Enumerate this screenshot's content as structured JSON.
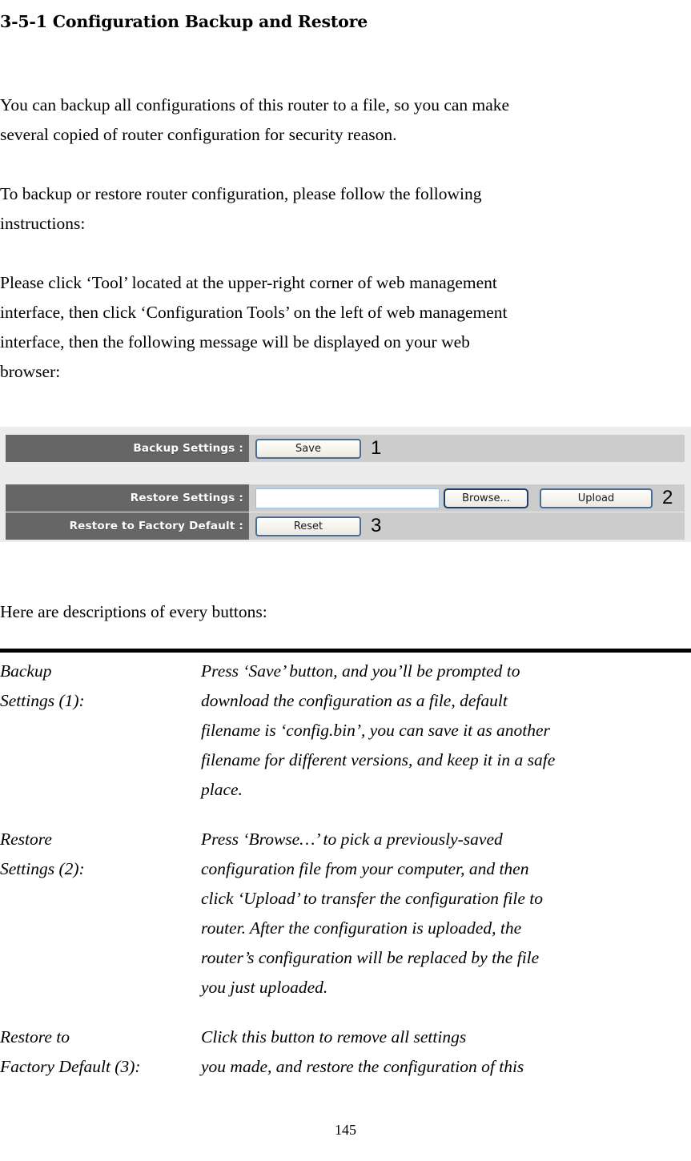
{
  "document": {
    "heading": "3-5-1 Configuration Backup and Restore",
    "page_number": "145",
    "paragraphs": [
      {
        "id": "intro",
        "lines": [
          "You can backup all configurations of this router to a file, so you can make",
          "several copied of router configuration for security reason."
        ]
      },
      {
        "id": "instructions",
        "lines": [
          "To backup or restore router configuration, please follow the following",
          "instructions:"
        ]
      },
      {
        "id": "navigation",
        "lines": [
          "Please click ‘Tool’ located at the upper-right corner of web management",
          "interface, then click ‘Configuration Tools’ on the left of web management",
          "interface, then the following message will be displayed on your web",
          "browser:"
        ]
      }
    ],
    "lead_in": "Here are descriptions of every buttons:"
  },
  "ui_panel": {
    "colors": {
      "panel_background": "#ececec",
      "row_background": "#cccccc",
      "label_background": "#666666",
      "label_text": "#ffffff",
      "button_border": "#4a6d96",
      "browse_border": "#1c3f6b",
      "input_border": "#9ec0e0"
    },
    "rows": [
      {
        "label": "Backup Settings :",
        "button": "Save",
        "callout": "1"
      },
      {
        "label": "Restore Settings :",
        "input_value": "",
        "input_placeholder": "",
        "browse_button": "Browse...",
        "button": "Upload",
        "callout": "2"
      },
      {
        "label": "Restore to Factory Default :",
        "button": "Reset",
        "callout": "3"
      }
    ]
  },
  "descriptions": [
    {
      "term_lines": [
        "Backup",
        "Settings (1):"
      ],
      "definition_lines": [
        "Press ‘Save’ button, and you’ll be prompted to",
        "download the configuration as a file, default",
        "filename is ‘config.bin’, you can save it as another",
        "filename for different versions, and keep it in a safe",
        "place."
      ]
    },
    {
      "term_lines": [
        "Restore",
        "Settings (2):"
      ],
      "definition_lines": [
        "Press ‘Browse…’ to pick a previously-saved",
        "configuration file from your computer, and then",
        "click ‘Upload’ to transfer the configuration file to",
        "router. After the configuration is uploaded, the",
        "router’s configuration will be replaced by the file",
        "you just uploaded."
      ]
    },
    {
      "term_lines": [
        "Restore to",
        "Factory Default (3):"
      ],
      "definition_lines": [
        "Click this button to remove all settings",
        "you made, and restore the configuration of this"
      ]
    }
  ]
}
